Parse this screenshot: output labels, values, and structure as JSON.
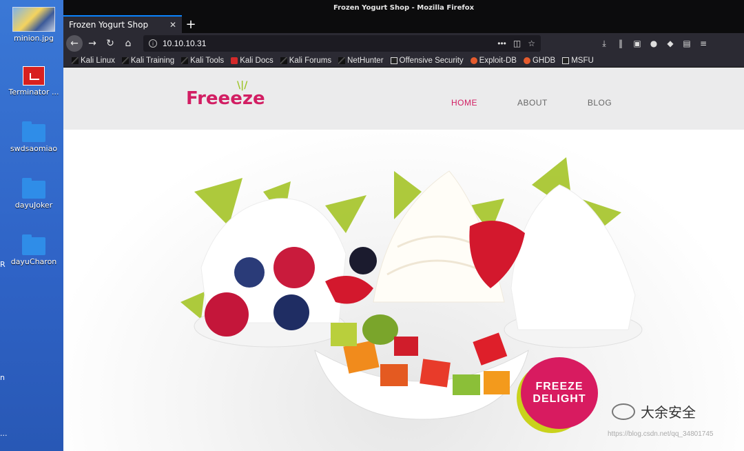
{
  "desktop": {
    "icons": [
      {
        "label": "minion.jpg"
      },
      {
        "label": "Terminator ..."
      },
      {
        "label": "swdsaomiao"
      },
      {
        "label": "dayuJoker"
      },
      {
        "label": "dayuCharon"
      }
    ],
    "edge_marks": [
      "R",
      "n",
      "..."
    ]
  },
  "browser": {
    "window_title": "Frozen Yogurt Shop - Mozilla Firefox",
    "tab_title": "Frozen Yogurt Shop",
    "url": "10.10.10.31",
    "bookmarks": [
      {
        "label": "Kali Linux",
        "icon": "kali-icon"
      },
      {
        "label": "Kali Training",
        "icon": "kali-icon"
      },
      {
        "label": "Kali Tools",
        "icon": "kali-icon"
      },
      {
        "label": "Kali Docs",
        "icon": "red-icon"
      },
      {
        "label": "Kali Forums",
        "icon": "kali-icon"
      },
      {
        "label": "NetHunter",
        "icon": "kali-icon"
      },
      {
        "label": "Offensive Security",
        "icon": "offsec-icon"
      },
      {
        "label": "Exploit-DB",
        "icon": "orange-icon"
      },
      {
        "label": "GHDB",
        "icon": "orange-icon"
      },
      {
        "label": "MSFU",
        "icon": "offsec-icon"
      }
    ]
  },
  "site": {
    "logo": "Freeeze",
    "nav": [
      {
        "label": "HOME",
        "active": true
      },
      {
        "label": "ABOUT",
        "active": false
      },
      {
        "label": "BLOG",
        "active": false
      }
    ],
    "badge_line1": "FREEZE",
    "badge_line2": "DELIGHT"
  },
  "watermark": {
    "text": "大余安全",
    "url": "https://blog.csdn.net/qq_34801745"
  },
  "colors": {
    "accent": "#d21e63",
    "leaf": "#9fc52b",
    "badge_yellow": "#c9d21c"
  }
}
